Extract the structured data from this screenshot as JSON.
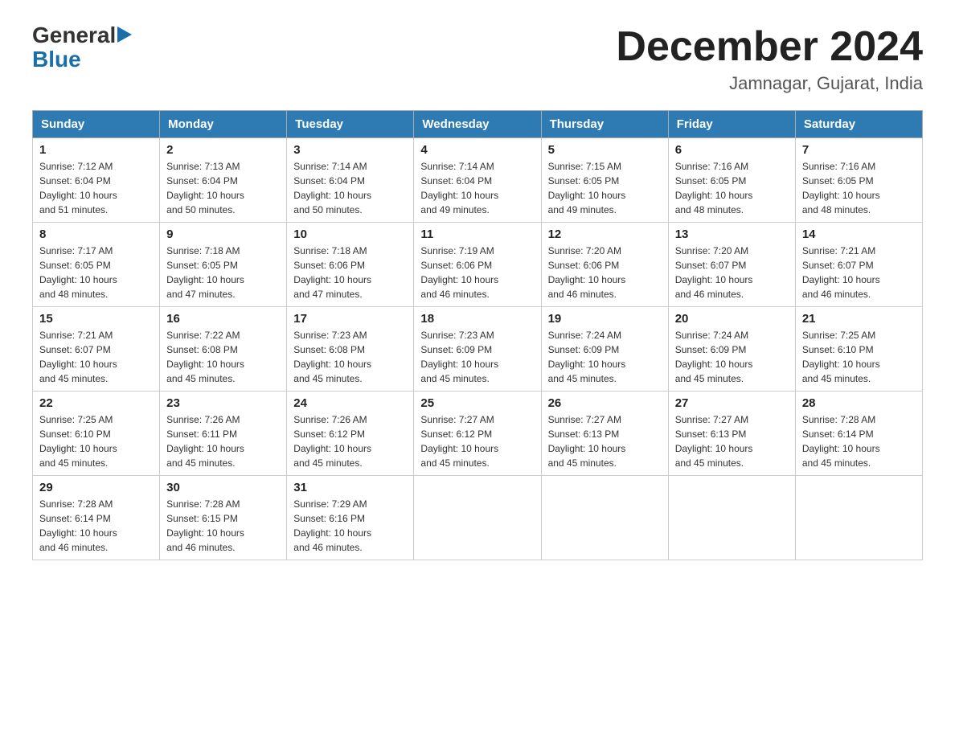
{
  "header": {
    "logo_general": "General",
    "logo_blue": "Blue",
    "title": "December 2024",
    "subtitle": "Jamnagar, Gujarat, India"
  },
  "calendar": {
    "days_of_week": [
      "Sunday",
      "Monday",
      "Tuesday",
      "Wednesday",
      "Thursday",
      "Friday",
      "Saturday"
    ],
    "weeks": [
      [
        {
          "day": "1",
          "sunrise": "7:12 AM",
          "sunset": "6:04 PM",
          "daylight": "10 hours and 51 minutes."
        },
        {
          "day": "2",
          "sunrise": "7:13 AM",
          "sunset": "6:04 PM",
          "daylight": "10 hours and 50 minutes."
        },
        {
          "day": "3",
          "sunrise": "7:14 AM",
          "sunset": "6:04 PM",
          "daylight": "10 hours and 50 minutes."
        },
        {
          "day": "4",
          "sunrise": "7:14 AM",
          "sunset": "6:04 PM",
          "daylight": "10 hours and 49 minutes."
        },
        {
          "day": "5",
          "sunrise": "7:15 AM",
          "sunset": "6:05 PM",
          "daylight": "10 hours and 49 minutes."
        },
        {
          "day": "6",
          "sunrise": "7:16 AM",
          "sunset": "6:05 PM",
          "daylight": "10 hours and 48 minutes."
        },
        {
          "day": "7",
          "sunrise": "7:16 AM",
          "sunset": "6:05 PM",
          "daylight": "10 hours and 48 minutes."
        }
      ],
      [
        {
          "day": "8",
          "sunrise": "7:17 AM",
          "sunset": "6:05 PM",
          "daylight": "10 hours and 48 minutes."
        },
        {
          "day": "9",
          "sunrise": "7:18 AM",
          "sunset": "6:05 PM",
          "daylight": "10 hours and 47 minutes."
        },
        {
          "day": "10",
          "sunrise": "7:18 AM",
          "sunset": "6:06 PM",
          "daylight": "10 hours and 47 minutes."
        },
        {
          "day": "11",
          "sunrise": "7:19 AM",
          "sunset": "6:06 PM",
          "daylight": "10 hours and 46 minutes."
        },
        {
          "day": "12",
          "sunrise": "7:20 AM",
          "sunset": "6:06 PM",
          "daylight": "10 hours and 46 minutes."
        },
        {
          "day": "13",
          "sunrise": "7:20 AM",
          "sunset": "6:07 PM",
          "daylight": "10 hours and 46 minutes."
        },
        {
          "day": "14",
          "sunrise": "7:21 AM",
          "sunset": "6:07 PM",
          "daylight": "10 hours and 46 minutes."
        }
      ],
      [
        {
          "day": "15",
          "sunrise": "7:21 AM",
          "sunset": "6:07 PM",
          "daylight": "10 hours and 45 minutes."
        },
        {
          "day": "16",
          "sunrise": "7:22 AM",
          "sunset": "6:08 PM",
          "daylight": "10 hours and 45 minutes."
        },
        {
          "day": "17",
          "sunrise": "7:23 AM",
          "sunset": "6:08 PM",
          "daylight": "10 hours and 45 minutes."
        },
        {
          "day": "18",
          "sunrise": "7:23 AM",
          "sunset": "6:09 PM",
          "daylight": "10 hours and 45 minutes."
        },
        {
          "day": "19",
          "sunrise": "7:24 AM",
          "sunset": "6:09 PM",
          "daylight": "10 hours and 45 minutes."
        },
        {
          "day": "20",
          "sunrise": "7:24 AM",
          "sunset": "6:09 PM",
          "daylight": "10 hours and 45 minutes."
        },
        {
          "day": "21",
          "sunrise": "7:25 AM",
          "sunset": "6:10 PM",
          "daylight": "10 hours and 45 minutes."
        }
      ],
      [
        {
          "day": "22",
          "sunrise": "7:25 AM",
          "sunset": "6:10 PM",
          "daylight": "10 hours and 45 minutes."
        },
        {
          "day": "23",
          "sunrise": "7:26 AM",
          "sunset": "6:11 PM",
          "daylight": "10 hours and 45 minutes."
        },
        {
          "day": "24",
          "sunrise": "7:26 AM",
          "sunset": "6:12 PM",
          "daylight": "10 hours and 45 minutes."
        },
        {
          "day": "25",
          "sunrise": "7:27 AM",
          "sunset": "6:12 PM",
          "daylight": "10 hours and 45 minutes."
        },
        {
          "day": "26",
          "sunrise": "7:27 AM",
          "sunset": "6:13 PM",
          "daylight": "10 hours and 45 minutes."
        },
        {
          "day": "27",
          "sunrise": "7:27 AM",
          "sunset": "6:13 PM",
          "daylight": "10 hours and 45 minutes."
        },
        {
          "day": "28",
          "sunrise": "7:28 AM",
          "sunset": "6:14 PM",
          "daylight": "10 hours and 45 minutes."
        }
      ],
      [
        {
          "day": "29",
          "sunrise": "7:28 AM",
          "sunset": "6:14 PM",
          "daylight": "10 hours and 46 minutes."
        },
        {
          "day": "30",
          "sunrise": "7:28 AM",
          "sunset": "6:15 PM",
          "daylight": "10 hours and 46 minutes."
        },
        {
          "day": "31",
          "sunrise": "7:29 AM",
          "sunset": "6:16 PM",
          "daylight": "10 hours and 46 minutes."
        },
        null,
        null,
        null,
        null
      ]
    ],
    "labels": {
      "sunrise": "Sunrise:",
      "sunset": "Sunset:",
      "daylight": "Daylight:"
    }
  }
}
